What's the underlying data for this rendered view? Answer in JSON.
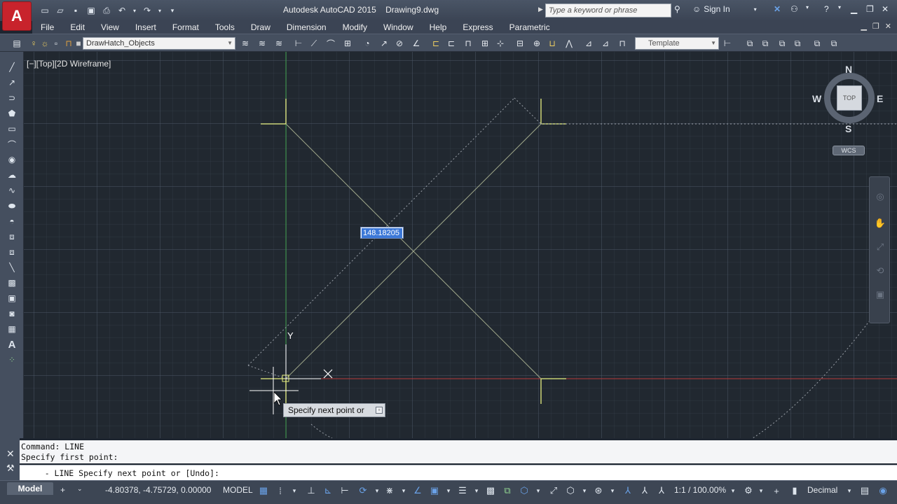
{
  "titlebar": {
    "app_logo": "A",
    "title": "Autodesk AutoCAD 2015    Drawing9.dwg",
    "search_placeholder": "Type a keyword or phrase",
    "sign_in": "Sign In"
  },
  "menu": [
    "File",
    "Edit",
    "View",
    "Insert",
    "Format",
    "Tools",
    "Draw",
    "Dimension",
    "Modify",
    "Window",
    "Help",
    "Express",
    "Parametric"
  ],
  "toolbar": {
    "layer_name": "DrawHatch_Objects",
    "template": "Template"
  },
  "viewport": {
    "label": "[−][Top][2D Wireframe]",
    "dynamic_input_value": "148.18205",
    "tooltip": "Specify next point or",
    "tooltip_btn": "▫",
    "ucs_y": "Y"
  },
  "viewcube": {
    "top": "TOP",
    "n": "N",
    "s": "S",
    "e": "E",
    "w": "W",
    "wcs": "WCS"
  },
  "command": {
    "history": [
      "Command:  LINE",
      "Specify first point:"
    ],
    "current": "    - LINE Specify next point or [Undo]:"
  },
  "status": {
    "model_tab": "Model",
    "coords": "-4.80378, -4.75729, 0.00000",
    "model": "MODEL",
    "scale": "1:1 / 100.00%",
    "units": "Decimal"
  },
  "colors": {
    "canvas": "#212830",
    "crosshair": "#e8f080",
    "x_axis": "#b83a3a",
    "y_axis": "#3a9a46",
    "command_bg": "#f4f5f7"
  }
}
